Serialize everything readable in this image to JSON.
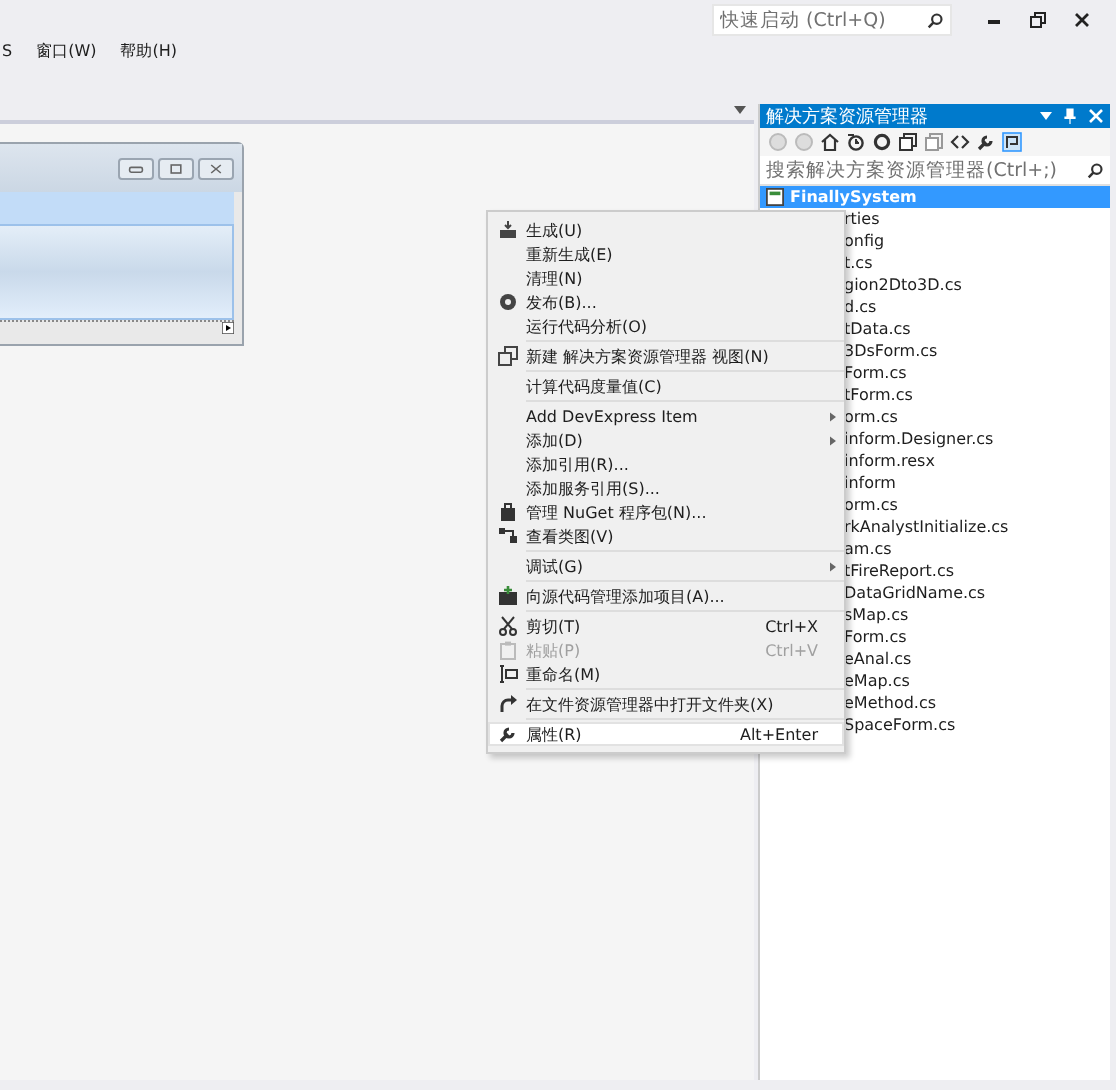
{
  "menu_bar": [
    "S",
    "窗口(W)",
    "帮助(H)"
  ],
  "quick_launch": {
    "placeholder": "快速启动 (Ctrl+Q)"
  },
  "solution_explorer": {
    "title": "解决方案资源管理器",
    "search": {
      "placeholder": "搜索解决方案资源管理器(Ctrl+;)"
    },
    "tree": [
      {
        "label": "FinallySystem",
        "selected": true,
        "children": [
          {
            "label": "rties",
            "selected": false
          },
          {
            "label": "onfig",
            "selected": false
          },
          {
            "label": "t.cs",
            "selected": false
          },
          {
            "label": "gion2Dto3D.cs",
            "selected": false
          },
          {
            "label": "d.cs",
            "selected": false
          },
          {
            "label": "tData.cs",
            "selected": false
          },
          {
            "label": "3DsForm.cs",
            "selected": false
          },
          {
            "label": "Form.cs",
            "selected": false
          },
          {
            "label": "tForm.cs",
            "selected": false
          },
          {
            "label": "orm.cs",
            "selected": false
          },
          {
            "label": "inform.Designer.cs",
            "selected": false
          },
          {
            "label": "inform.resx",
            "selected": false
          },
          {
            "label": "inform",
            "selected": false
          },
          {
            "label": "orm.cs",
            "selected": false
          },
          {
            "label": "rkAnalystInitialize.cs",
            "selected": false
          },
          {
            "label": "am.cs",
            "selected": false
          },
          {
            "label": "tFireReport.cs",
            "selected": false
          },
          {
            "label": "DataGridName.cs",
            "selected": false
          },
          {
            "label": "sMap.cs",
            "selected": false
          },
          {
            "label": "Form.cs",
            "selected": false
          },
          {
            "label": "eAnal.cs",
            "selected": false
          },
          {
            "label": "eMap.cs",
            "selected": false
          },
          {
            "label": "eMethod.cs",
            "selected": false
          },
          {
            "label": "SpaceForm.cs",
            "selected": false
          }
        ]
      }
    ]
  },
  "context_menu": [
    {
      "kind": "item",
      "label": "生成(U)",
      "submenu": false,
      "disabled": false,
      "selected": false
    },
    {
      "kind": "item",
      "label": "重新生成(E)",
      "submenu": false,
      "disabled": false,
      "selected": false
    },
    {
      "kind": "item",
      "label": "清理(N)",
      "submenu": false,
      "disabled": false,
      "selected": false
    },
    {
      "kind": "item",
      "label": "发布(B)...",
      "submenu": false,
      "disabled": false,
      "selected": false
    },
    {
      "kind": "item",
      "label": "运行代码分析(O)",
      "submenu": false,
      "disabled": false,
      "selected": false
    },
    {
      "kind": "separator"
    },
    {
      "kind": "item",
      "label": "新建 解决方案资源管理器 视图(N)",
      "submenu": false,
      "disabled": false,
      "selected": false
    },
    {
      "kind": "separator"
    },
    {
      "kind": "item",
      "label": "计算代码度量值(C)",
      "submenu": false,
      "disabled": false,
      "selected": false
    },
    {
      "kind": "separator"
    },
    {
      "kind": "item",
      "label": "Add DevExpress Item",
      "submenu": true,
      "disabled": false,
      "selected": false
    },
    {
      "kind": "item",
      "label": "添加(D)",
      "submenu": true,
      "disabled": false,
      "selected": false
    },
    {
      "kind": "item",
      "label": "添加引用(R)...",
      "submenu": false,
      "disabled": false,
      "selected": false
    },
    {
      "kind": "item",
      "label": "添加服务引用(S)...",
      "submenu": false,
      "disabled": false,
      "selected": false
    },
    {
      "kind": "item",
      "label": "管理 NuGet 程序包(N)...",
      "submenu": false,
      "disabled": false,
      "selected": false
    },
    {
      "kind": "item",
      "label": "查看类图(V)",
      "submenu": false,
      "disabled": false,
      "selected": false
    },
    {
      "kind": "separator"
    },
    {
      "kind": "item",
      "label": "调试(G)",
      "submenu": true,
      "disabled": false,
      "selected": false
    },
    {
      "kind": "separator"
    },
    {
      "kind": "item",
      "label": "向源代码管理添加项目(A)...",
      "submenu": false,
      "disabled": false,
      "selected": false
    },
    {
      "kind": "separator"
    },
    {
      "kind": "item",
      "label": "剪切(T)",
      "shortcut": "Ctrl+X",
      "submenu": false,
      "disabled": false,
      "selected": false
    },
    {
      "kind": "item",
      "label": "粘贴(P)",
      "shortcut": "Ctrl+V",
      "submenu": false,
      "disabled": true,
      "selected": false
    },
    {
      "kind": "item",
      "label": "重命名(M)",
      "submenu": false,
      "disabled": false,
      "selected": false
    },
    {
      "kind": "separator"
    },
    {
      "kind": "item",
      "label": "在文件资源管理器中打开文件夹(X)",
      "submenu": false,
      "disabled": false,
      "selected": false
    },
    {
      "kind": "separator"
    },
    {
      "kind": "item",
      "label": "属性(R)",
      "shortcut": "Alt+Enter",
      "submenu": false,
      "disabled": false,
      "selected": true
    }
  ]
}
